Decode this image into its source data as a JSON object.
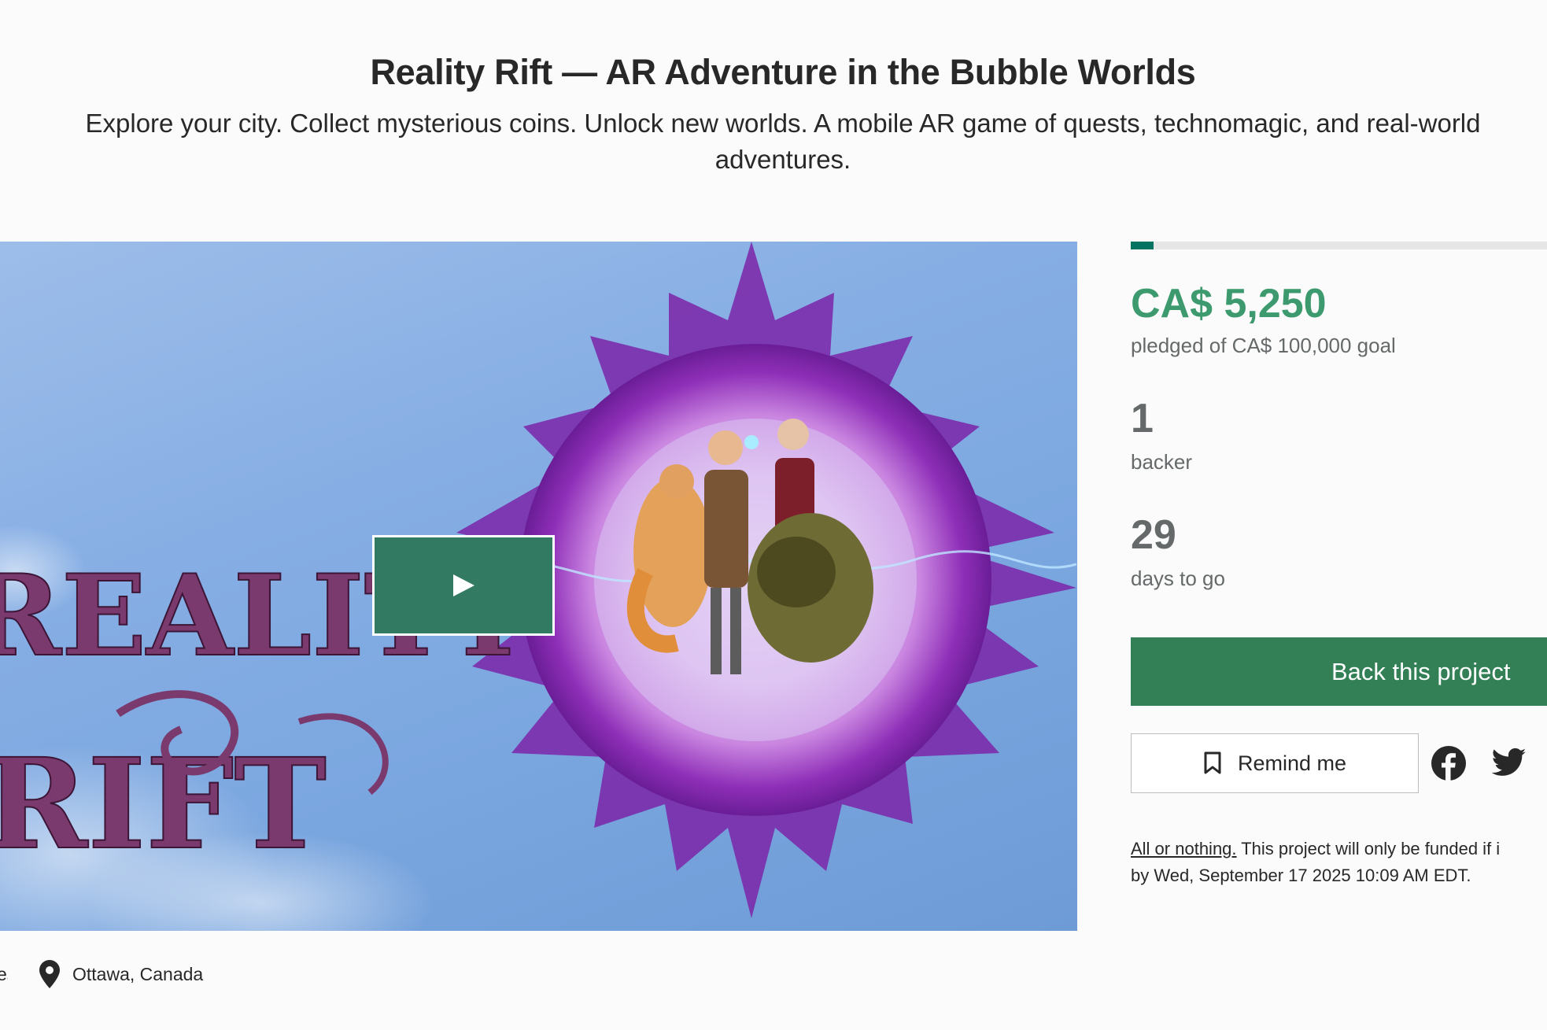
{
  "project": {
    "title": "Reality Rift — AR Adventure in the Bubble Worlds",
    "blurb_line1": "Explore your city. Collect mysterious coins. Unlock new worlds. A mobile AR game of quests, technomagic, and real-world",
    "blurb_line2": "adventures."
  },
  "media": {
    "logo_line1": "REALITY",
    "logo_line2": "RIFT"
  },
  "location": {
    "category_fragment": "es",
    "city": "Ottawa, Canada"
  },
  "funding": {
    "progress_fraction": 0.0525,
    "pledged": "CA$ 5,250",
    "goal_text": "pledged of CA$ 100,000 goal",
    "backers_count": "1",
    "backers_label": "backer",
    "days_count": "29",
    "days_label": "days to go"
  },
  "actions": {
    "back_label": "Back this project",
    "remind_label": "Remind me"
  },
  "notice": {
    "link": "All or nothing.",
    "text": " This project will only be funded if i",
    "deadline": "by Wed, September 17 2025 10:09 AM EDT."
  },
  "colors": {
    "accent_green": "#3c9a6e",
    "button_green": "#338057",
    "play_green": "#327a62"
  },
  "icons": [
    "play-icon",
    "map-pin-icon",
    "bookmark-icon",
    "facebook-icon",
    "twitter-icon"
  ]
}
